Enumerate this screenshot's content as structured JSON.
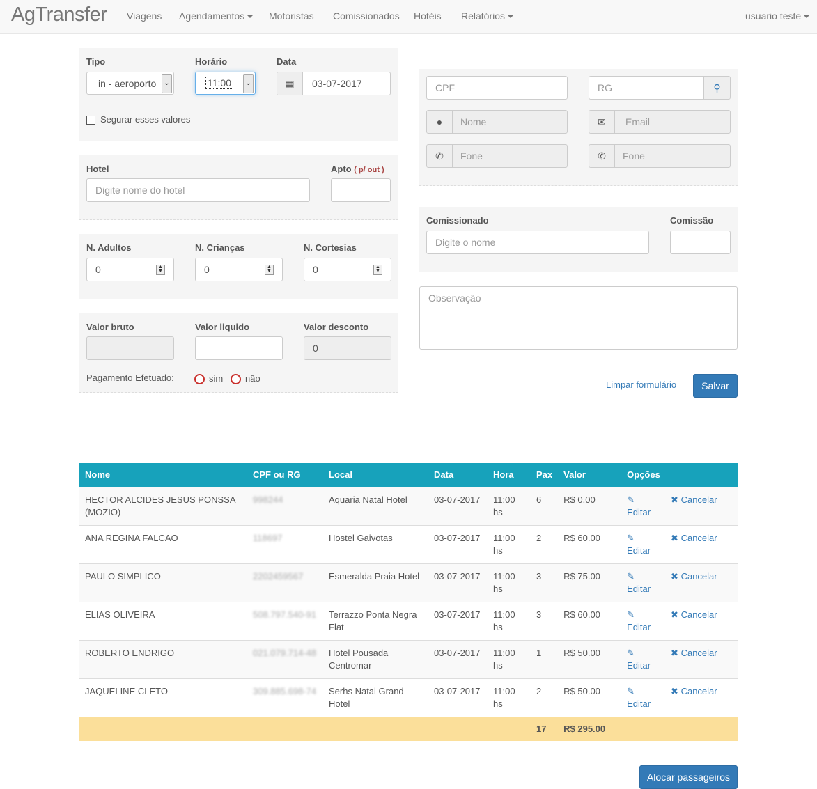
{
  "navbar": {
    "brand": "AgTransfer",
    "items": [
      "Viagens",
      "Agendamentos",
      "Motoristas",
      "Comissionados",
      "Hotéis",
      "Relatórios"
    ],
    "user": "usuario teste"
  },
  "form": {
    "tipo_label": "Tipo",
    "tipo_value": "in - aeroporto",
    "horario_label": "Horário",
    "horario_value": "11:00",
    "data_label": "Data",
    "data_value": "03-07-2017",
    "segurar_label": "Segurar esses valores",
    "hotel_label": "Hotel",
    "hotel_placeholder": "Digite nome do hotel",
    "apto_label": "Apto",
    "apto_hint": "( p/ out )",
    "adultos_label": "N. Adultos",
    "adultos_value": "0",
    "criancas_label": "N. Crianças",
    "criancas_value": "0",
    "cortesias_label": "N. Cortesias",
    "cortesias_value": "0",
    "valor_bruto_label": "Valor bruto",
    "valor_liquido_label": "Valor liquido",
    "valor_desconto_label": "Valor desconto",
    "valor_desconto_value": "0",
    "pagamento_label": "Pagamento Efetuado:",
    "sim_label": "sim",
    "nao_label": "não",
    "cpf_placeholder": "CPF",
    "rg_placeholder": "RG",
    "nome_placeholder": "Nome",
    "email_placeholder": "Email",
    "fone1_placeholder": "Fone",
    "fone2_placeholder": "Fone",
    "comissionado_label": "Comissionado",
    "comissionado_placeholder": "Digite o nome",
    "comissao_label": "Comissão",
    "observacao_placeholder": "Observação",
    "limpar_label": "Limpar formulário",
    "salvar_label": "Salvar"
  },
  "table": {
    "headers": [
      "Nome",
      "CPF ou RG",
      "Local",
      "Data",
      "Hora",
      "Pax",
      "Valor",
      "Opções"
    ],
    "rows": [
      {
        "nome": "HECTOR ALCIDES JESUS PONSSA (MOZIO)",
        "doc": "998244",
        "local": "Aquaria Natal Hotel",
        "data": "03-07-2017",
        "hora": "11:00 hs",
        "pax": "6",
        "valor": "R$ 0.00"
      },
      {
        "nome": "ANA REGINA FALCAO",
        "doc": "118697",
        "local": "Hostel Gaivotas",
        "data": "03-07-2017",
        "hora": "11:00 hs",
        "pax": "2",
        "valor": "R$ 60.00"
      },
      {
        "nome": "PAULO SIMPLICO",
        "doc": "2202459567",
        "local": "Esmeralda Praia Hotel",
        "data": "03-07-2017",
        "hora": "11:00 hs",
        "pax": "3",
        "valor": "R$ 75.00"
      },
      {
        "nome": "ELIAS OLIVEIRA",
        "doc": "508.797.540-91",
        "local": "Terrazzo Ponta Negra Flat",
        "data": "03-07-2017",
        "hora": "11:00 hs",
        "pax": "3",
        "valor": "R$ 60.00"
      },
      {
        "nome": "ROBERTO ENDRIGO",
        "doc": "021.079.714-48",
        "local": "Hotel Pousada Centromar",
        "data": "03-07-2017",
        "hora": "11:00 hs",
        "pax": "1",
        "valor": "R$ 50.00"
      },
      {
        "nome": "JAQUELINE CLETO",
        "doc": "309.885.698-74",
        "local": "Serhs Natal Grand Hotel",
        "data": "03-07-2017",
        "hora": "11:00 hs",
        "pax": "2",
        "valor": "R$ 50.00"
      }
    ],
    "edit_label": "Editar",
    "cancel_label": "Cancelar",
    "total_pax": "17",
    "total_valor": "R$ 295.00"
  },
  "alocar_label": "Alocar passageiros"
}
